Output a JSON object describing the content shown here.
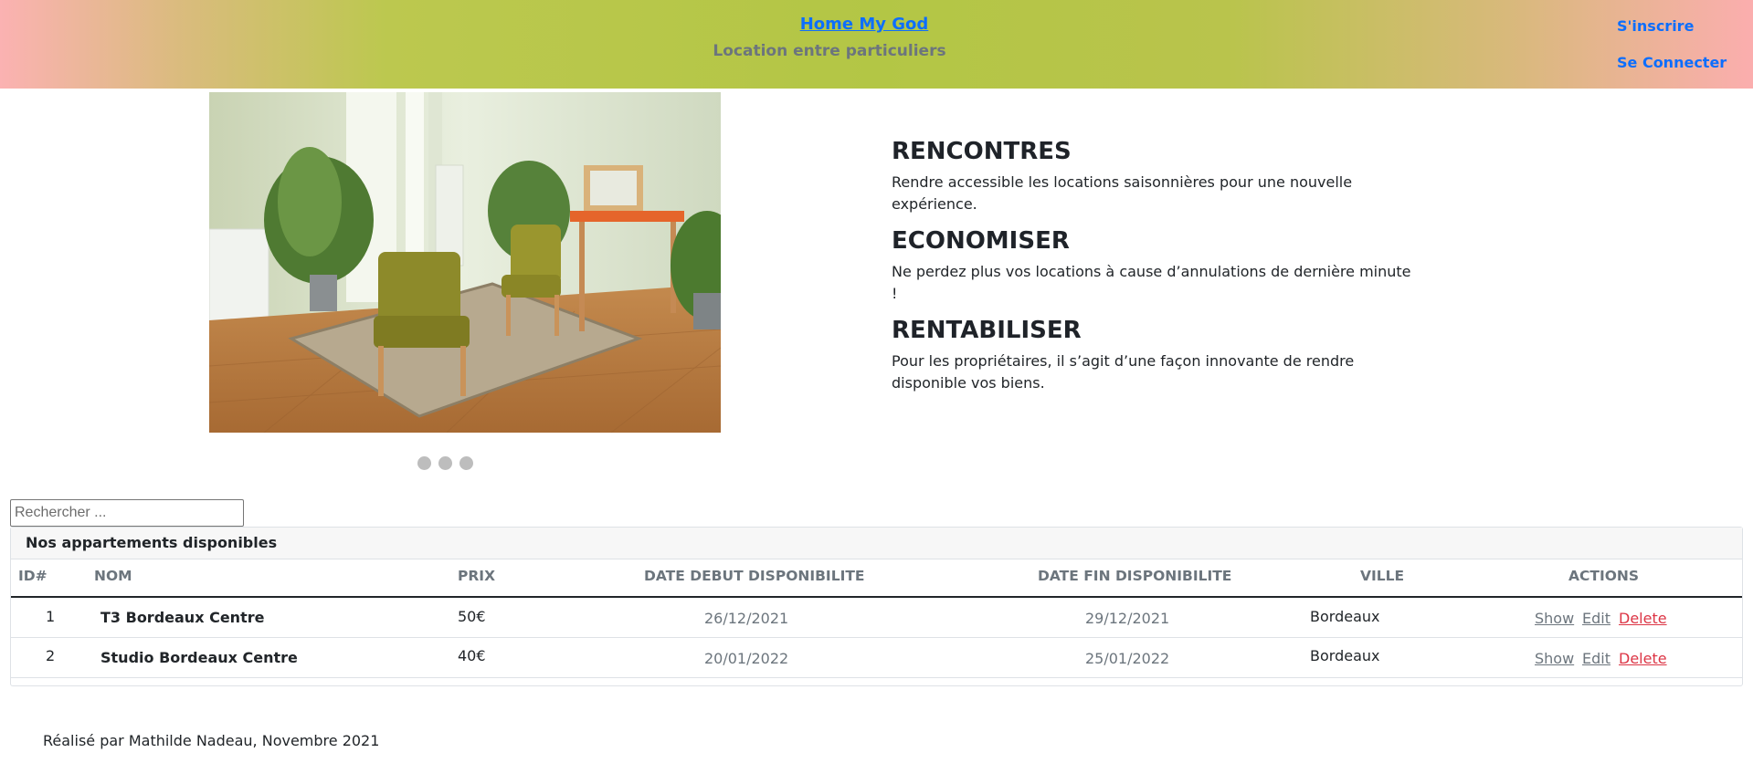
{
  "header": {
    "title": "Home My God",
    "subtitle": "Location entre particuliers",
    "signup_label": "S'inscrire",
    "login_label": "Se Connecter"
  },
  "carousel": {
    "slide_count": 3,
    "active_slide": 1
  },
  "features": [
    {
      "heading": "RENCONTRES",
      "text": "Rendre accessible les locations saisonnières pour une nouvelle expérience."
    },
    {
      "heading": "ECONOMISER",
      "text": "Ne perdez plus vos locations à cause d’annulations de dernière minute !"
    },
    {
      "heading": "RENTABILISER",
      "text": "Pour les propriétaires, il s’agit d’une façon innovante de rendre disponible vos biens."
    }
  ],
  "search": {
    "placeholder": "Rechercher ...",
    "value": ""
  },
  "listings": {
    "title": "Nos appartements disponibles",
    "columns": [
      "ID#",
      "NOM",
      "PRIX",
      "DATE DEBUT DISPONIBILITE",
      "DATE FIN DISPONIBILITE",
      "VILLE",
      "ACTIONS"
    ],
    "rows": [
      {
        "id": "1",
        "name": "T3 Bordeaux Centre",
        "price": "50€",
        "start": "26/12/2021",
        "end": "29/12/2021",
        "city": "Bordeaux"
      },
      {
        "id": "2",
        "name": "Studio Bordeaux Centre",
        "price": "40€",
        "start": "20/01/2022",
        "end": "25/01/2022",
        "city": "Bordeaux"
      }
    ],
    "actions": {
      "show": "Show",
      "edit": "Edit",
      "delete": "Delete"
    }
  },
  "footer": {
    "text": "Réalisé par Mathilde Nadeau, Novembre 2021"
  },
  "colors": {
    "link": "#0d6efd",
    "muted": "#6c757d",
    "danger": "#dc3545",
    "header_center": "#b3c645",
    "header_edges": "#fbb2b2"
  }
}
